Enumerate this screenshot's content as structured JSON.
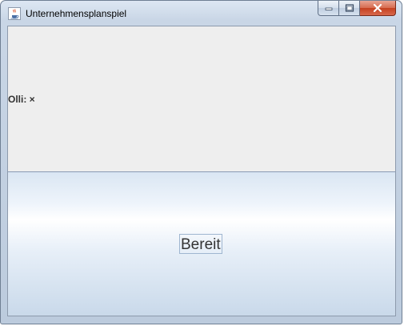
{
  "window": {
    "title": "Unternehmensplanspiel",
    "icon": "java-cup-icon",
    "caption_buttons": [
      "minimize-icon",
      "maximize-icon",
      "close-icon"
    ]
  },
  "top_panel": {
    "player_label": "Olli: ×"
  },
  "bottom_panel": {
    "ready_button_label": "Bereit"
  },
  "colors": {
    "content_background": "#eeeeee",
    "button_text": "#333333",
    "close_button": "#c4401f"
  }
}
